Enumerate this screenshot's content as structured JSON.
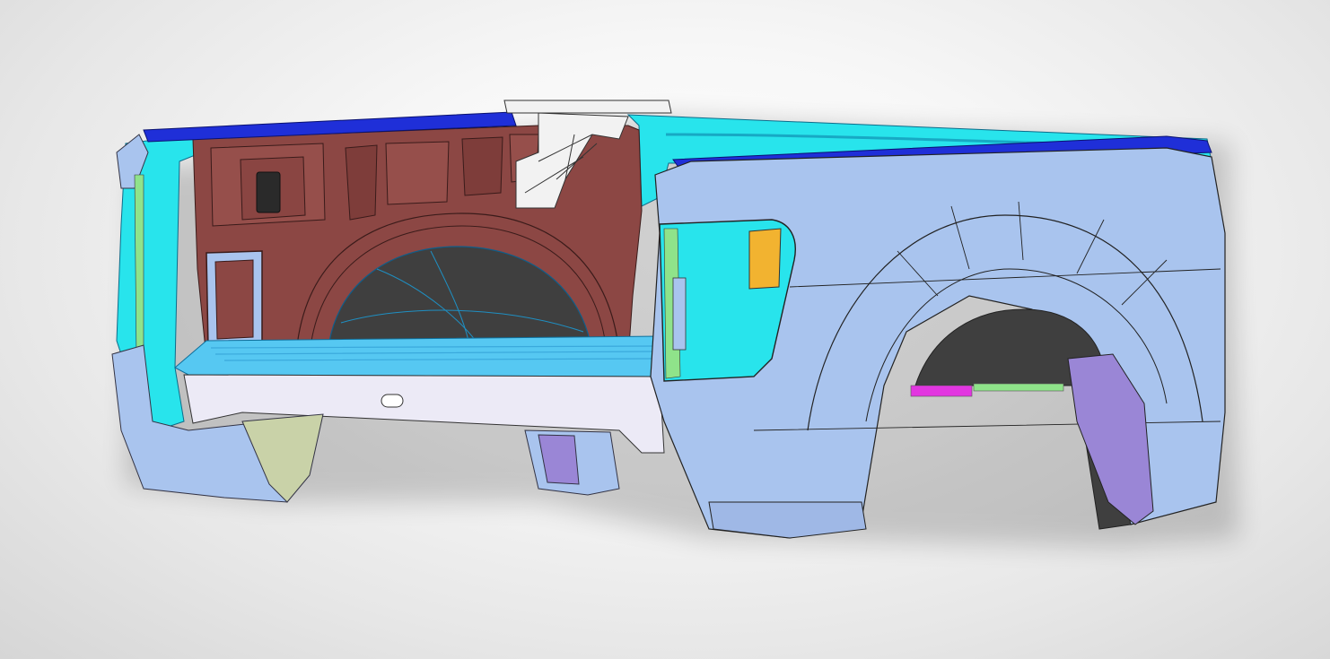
{
  "scene": {
    "subject": "pickup-truck-bed-cad-model",
    "colors": {
      "background": "#ececec",
      "inner_bed_wall": "#8c4744",
      "bed_rail_cyan": "#28e4ec",
      "top_rail_blue": "#1f2fd8",
      "outer_panel_blue": "#a9c4ee",
      "floor_cyan": "#56c8f2",
      "wheel_well_dark": "#3f3f3f",
      "bracket_white": "#f2f2f2",
      "latch_yellow": "#f2b330",
      "liner_purple": "#9a86d6",
      "green_trim": "#8fe38a",
      "magenta_part": "#e236e0"
    }
  }
}
